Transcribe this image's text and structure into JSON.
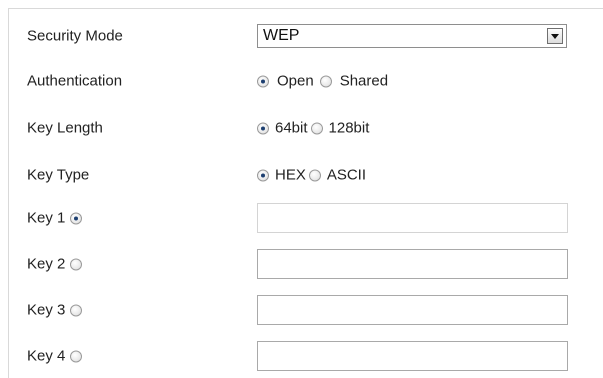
{
  "security_mode": {
    "label": "Security Mode",
    "value": "WEP"
  },
  "authentication": {
    "label": "Authentication",
    "options": [
      {
        "label": "Open",
        "checked": true
      },
      {
        "label": "Shared",
        "checked": false
      }
    ]
  },
  "key_length": {
    "label": "Key Length",
    "options": [
      {
        "label": "64bit",
        "checked": true
      },
      {
        "label": "128bit",
        "checked": false
      }
    ]
  },
  "key_type": {
    "label": "Key Type",
    "options": [
      {
        "label": "HEX",
        "checked": true
      },
      {
        "label": "ASCII",
        "checked": false
      }
    ]
  },
  "keys": [
    {
      "label": "Key 1",
      "selected": true,
      "value": ""
    },
    {
      "label": "Key 2",
      "selected": false,
      "value": ""
    },
    {
      "label": "Key 3",
      "selected": false,
      "value": ""
    },
    {
      "label": "Key 4",
      "selected": false,
      "value": ""
    }
  ],
  "icons": {
    "dropdown": "chevron-down-icon",
    "radio": "radio-button-icon"
  },
  "colors": {
    "radio_dot": "#1d3f70",
    "border": "#a9a9a9"
  }
}
